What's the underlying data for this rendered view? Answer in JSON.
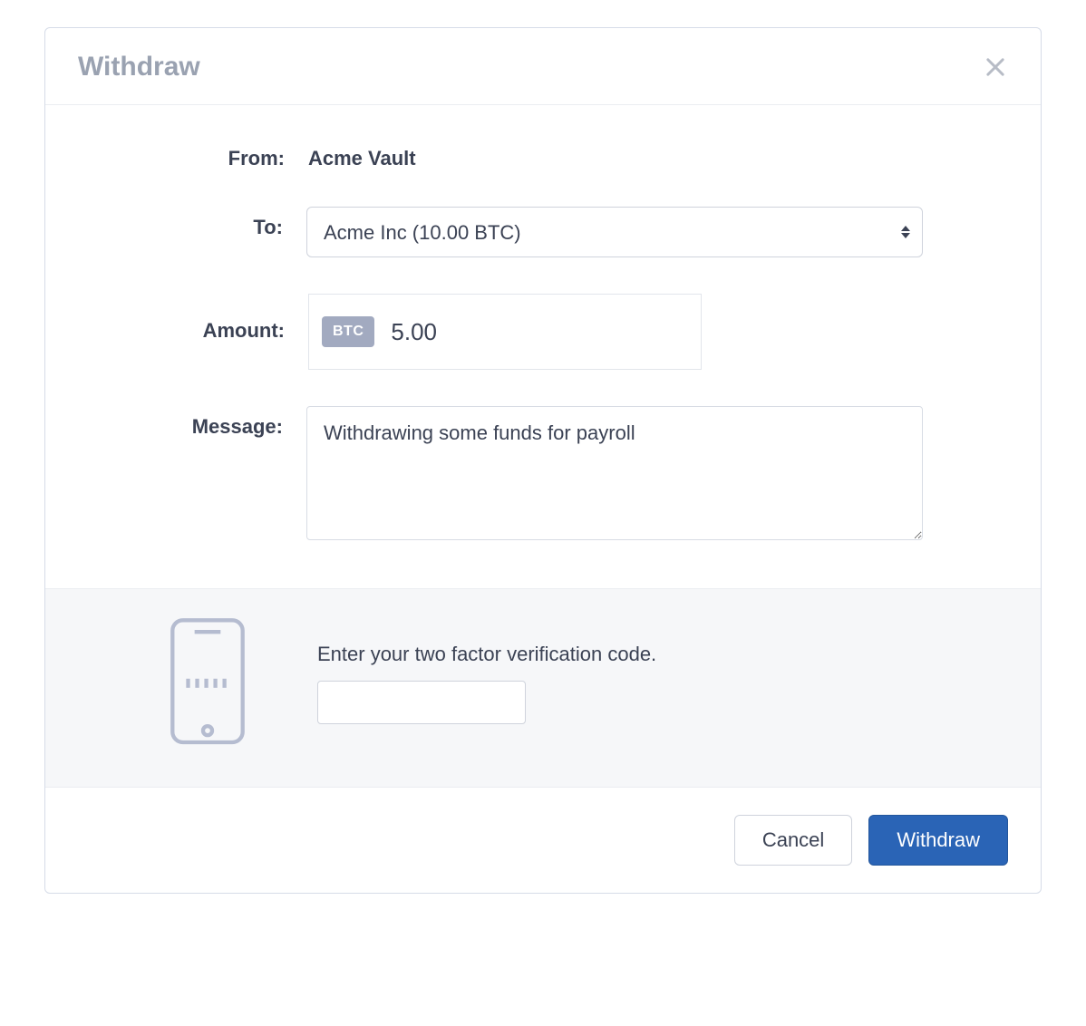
{
  "modal": {
    "title": "Withdraw"
  },
  "form": {
    "from_label": "From:",
    "from_value": "Acme Vault",
    "to_label": "To:",
    "to_selected": "Acme Inc (10.00 BTC)",
    "amount_label": "Amount:",
    "amount_currency": "BTC",
    "amount_value": "5.00",
    "message_label": "Message:",
    "message_value": "Withdrawing some funds for payroll"
  },
  "twofa": {
    "label": "Enter your two factor verification code.",
    "value": ""
  },
  "footer": {
    "cancel_label": "Cancel",
    "withdraw_label": "Withdraw"
  }
}
